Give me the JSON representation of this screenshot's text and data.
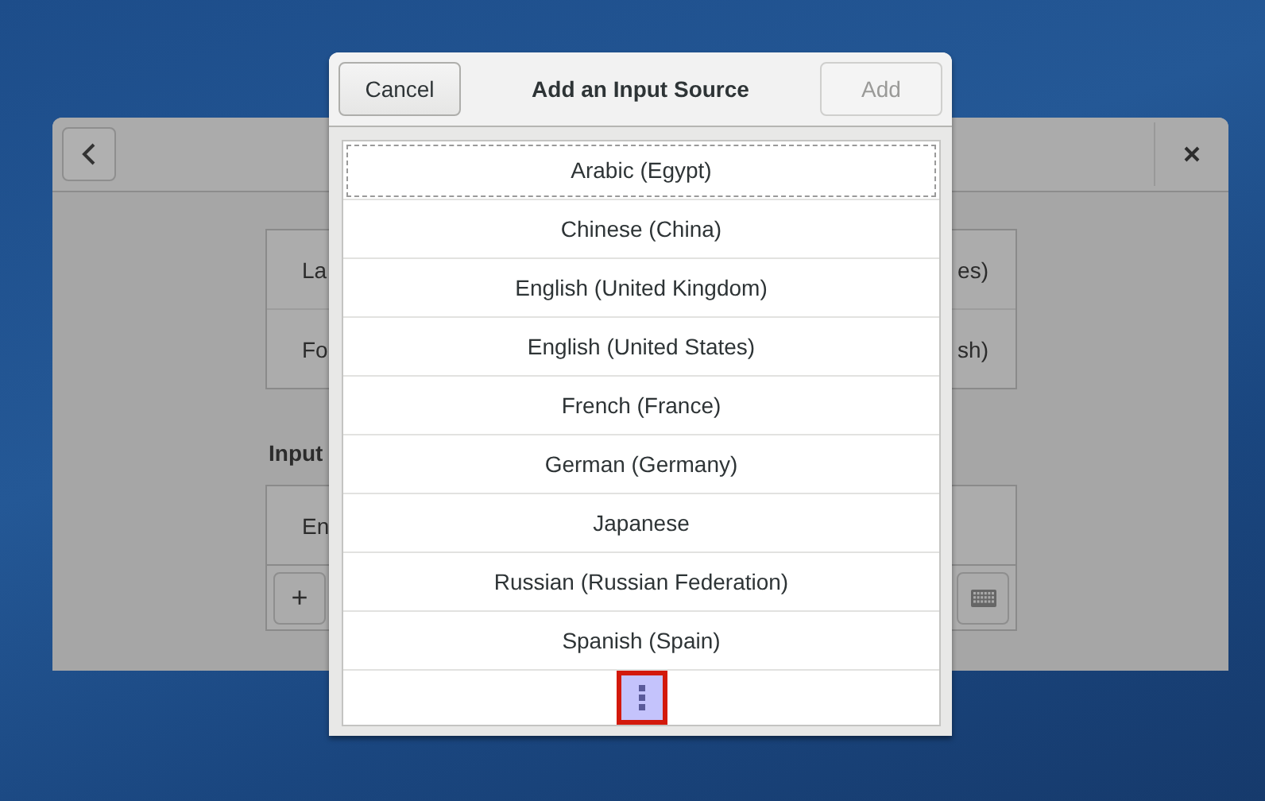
{
  "background_window": {
    "panel_rows": [
      {
        "left": "La",
        "right": "es)"
      },
      {
        "left": "Fo",
        "right": "sh)"
      }
    ],
    "section_label": "Input",
    "input_rows": [
      {
        "left": "En"
      }
    ],
    "toolbar": {
      "add": "+"
    }
  },
  "dialog": {
    "cancel": "Cancel",
    "title": "Add an Input Source",
    "add": {
      "label": "Add",
      "disabled": true
    },
    "items": [
      {
        "label": "Arabic (Egypt)",
        "focused": true
      },
      {
        "label": "Chinese (China)",
        "focused": false
      },
      {
        "label": "English (United Kingdom)",
        "focused": false
      },
      {
        "label": "English (United States)",
        "focused": false
      },
      {
        "label": "French (France)",
        "focused": false
      },
      {
        "label": "German (Germany)",
        "focused": false
      },
      {
        "label": "Japanese",
        "focused": false
      },
      {
        "label": "Russian (Russian Federation)",
        "focused": false
      },
      {
        "label": "Spanish (Spain)",
        "focused": false
      }
    ],
    "more": {
      "selected": true
    }
  }
}
